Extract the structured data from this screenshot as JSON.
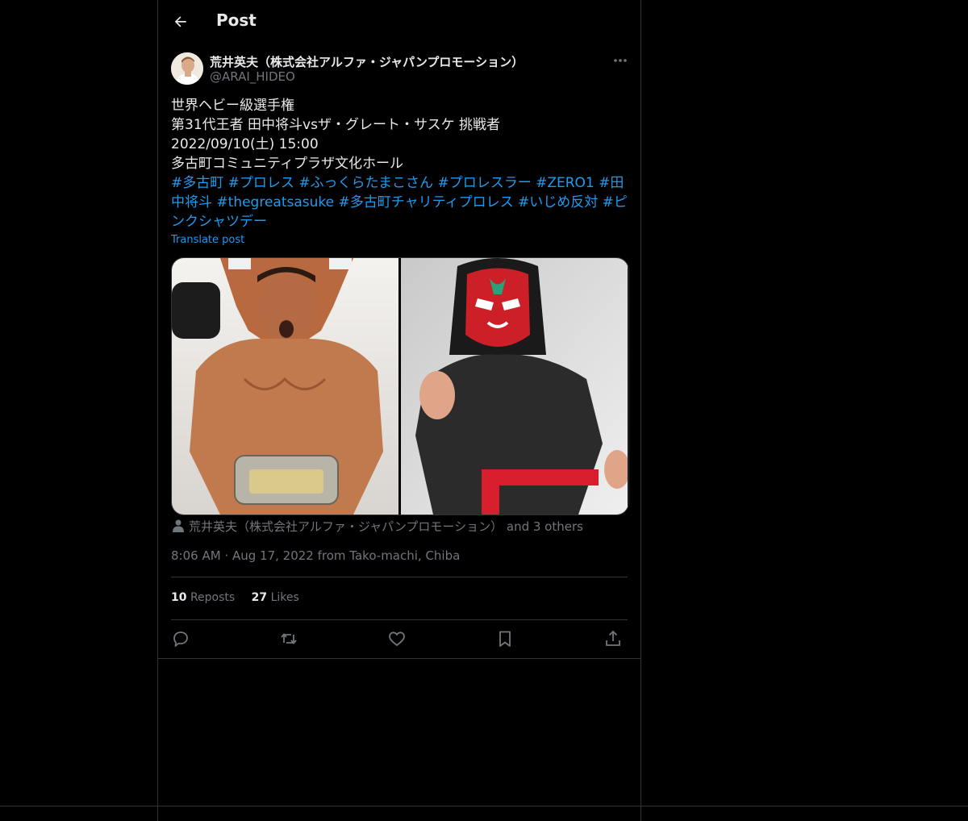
{
  "header": {
    "title": "Post",
    "back_icon": "arrow-left-icon"
  },
  "author": {
    "name": "荒井英夫（株式会社アルファ・ジャパンプロモーション）",
    "handle": "@ARAI_HIDEO",
    "more_icon": "more-horizontal-icon"
  },
  "post": {
    "lines": [
      "世界ヘビー級選手権",
      "第31代王者 田中将斗vsザ・グレート・サスケ 挑戦者",
      "2022/09/10(土) 15:00",
      "多古町コミュニティプラザ文化ホール"
    ],
    "hashtags": [
      "#多古町",
      "#プロレス",
      "#ふっくらたまこさん",
      "#プロレスラー",
      "#ZERO1",
      "#田中将斗",
      "#thegreatsasuke",
      "#多古町チャリティプロレス",
      "#いじめ反対",
      "#ピンクシャツデー"
    ],
    "translate_label": "Translate post"
  },
  "tagged": {
    "text": "荒井英夫（株式会社アルファ・ジャパンプロモーション） and 3 others",
    "icon": "person-icon"
  },
  "meta": {
    "time": "8:06 AM",
    "dot": "·",
    "date_location": "Aug 17, 2022 from Tako-machi, Chiba"
  },
  "stats": {
    "reposts_count": "10",
    "reposts_label": "Reposts",
    "likes_count": "27",
    "likes_label": "Likes"
  },
  "actions": [
    "reply-icon",
    "repost-icon",
    "like-icon",
    "bookmark-icon",
    "share-icon"
  ],
  "colors": {
    "background": "#000000",
    "text": "#e7e9ea",
    "secondary": "#71767b",
    "accent": "#1d9bf0",
    "border": "#2f3336"
  }
}
